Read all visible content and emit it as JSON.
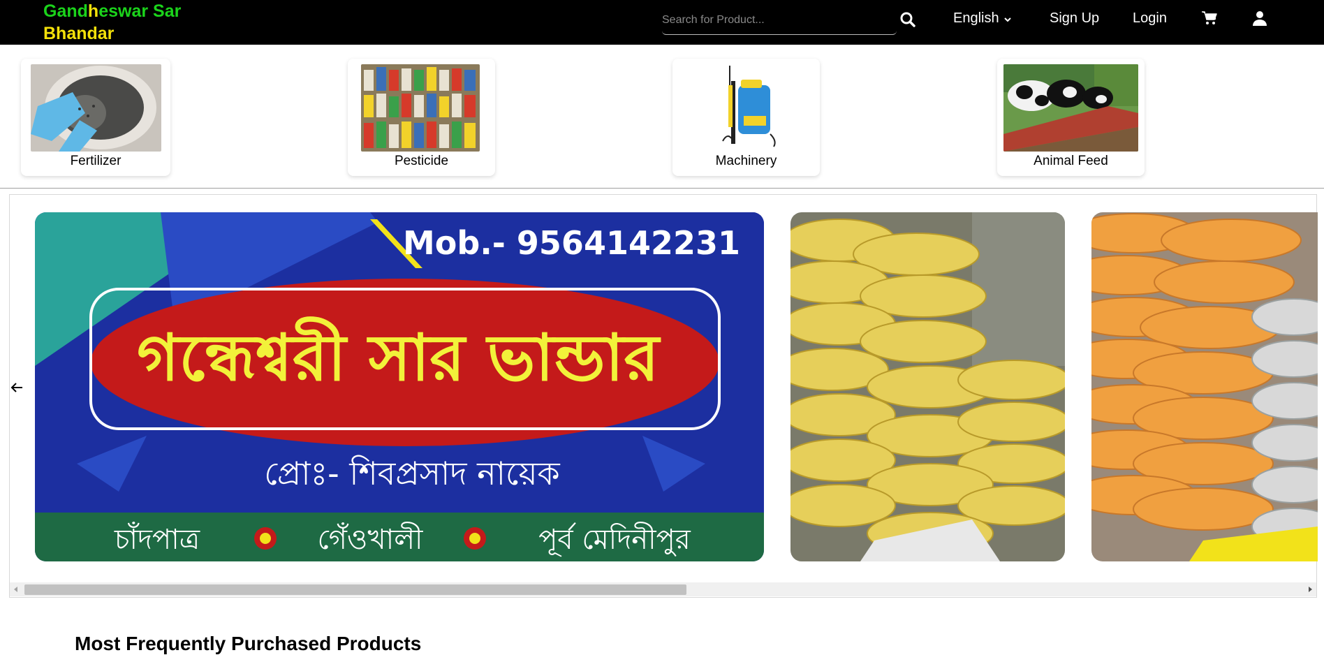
{
  "header": {
    "brand_line1_a": "Gand",
    "brand_line1_b": "h",
    "brand_line1_c": "eswar Sar",
    "brand_line2": "Bhandar",
    "search_placeholder": "Search for Product...",
    "language_label": "English",
    "signup_label": "Sign Up",
    "login_label": "Login"
  },
  "categories": [
    {
      "label": "Fertilizer"
    },
    {
      "label": "Pesticide"
    },
    {
      "label": "Machinery"
    },
    {
      "label": "Animal Feed"
    }
  ],
  "banner": {
    "mobile_text": "Mob.- 9564142231",
    "shop_name_bn": "গন্ধেশ্বরী সার ভান্ডার",
    "proprietor_bn": "প্রোঃ- শিবপ্রসাদ নায়েক",
    "address_1": "চাঁদপাত্র",
    "address_2": "গেঁওখালী",
    "address_3": "পূর্ব মেদিনীপুর"
  },
  "section": {
    "title": "Most Frequently Purchased Products"
  },
  "colors": {
    "brand_green": "#1bd31b",
    "brand_yellow": "#f4e10a",
    "header_bg": "#000000"
  }
}
